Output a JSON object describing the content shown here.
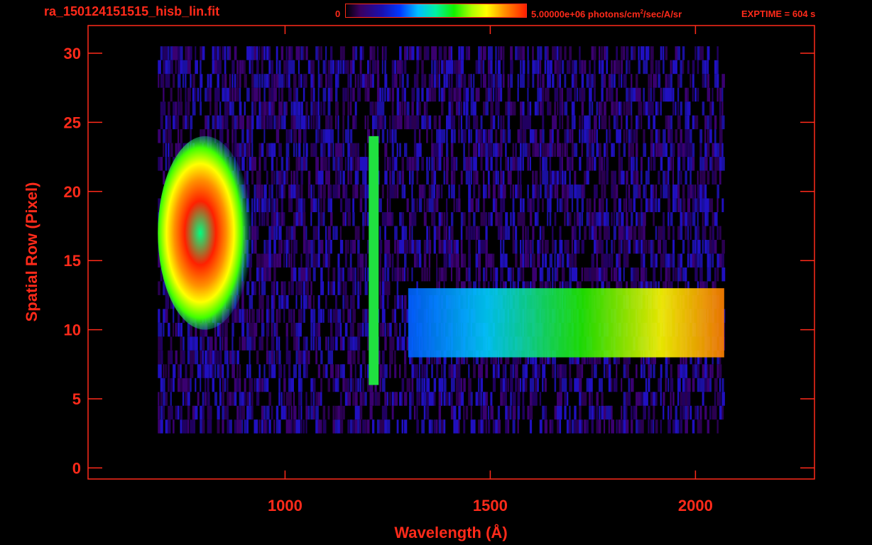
{
  "header": {
    "filename": "ra_150124151515_hisb_lin.fit",
    "colorbar_min": "0",
    "colorbar_unit_pre": "5.00000e+06 photons/cm",
    "colorbar_unit_sup": "2",
    "colorbar_unit_post": "/sec/A/sr",
    "exptime": "EXPTIME = 604 s"
  },
  "chart_data": {
    "type": "heatmap",
    "xlabel": "Wavelength (Å)",
    "ylabel": "Spatial Row (Pixel)",
    "xlim": [
      520,
      2290
    ],
    "ylim": [
      -0.8,
      32
    ],
    "x_ticks": [
      1000,
      1500,
      2000
    ],
    "y_ticks": [
      0,
      5,
      10,
      15,
      20,
      25,
      30
    ],
    "colorbar": {
      "min": 0,
      "max": 5000000
    },
    "emission_features": [
      {
        "name": "blob",
        "x_range": [
          690,
          920
        ],
        "y_range": [
          10,
          24
        ],
        "peak": "red"
      },
      {
        "name": "line",
        "x": 1216,
        "y_range": [
          6,
          24
        ],
        "peak": "green"
      },
      {
        "name": "continuum",
        "x_range": [
          1300,
          2070
        ],
        "y_range": [
          8,
          13
        ],
        "peak": "orange"
      }
    ],
    "grid": false
  }
}
